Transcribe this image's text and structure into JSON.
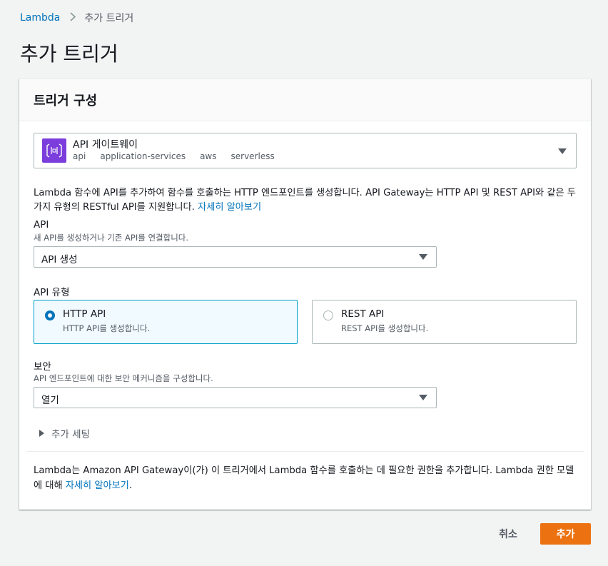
{
  "breadcrumb": {
    "root": "Lambda",
    "current": "추가 트리거"
  },
  "page": {
    "title": "추가 트리거"
  },
  "panel": {
    "title": "트리거 구성"
  },
  "trigger": {
    "name": "API 게이트웨이",
    "tags": [
      "api",
      "application-services",
      "aws",
      "serverless"
    ],
    "icon": "api-gateway-icon",
    "icon_color": "#7b3ddb"
  },
  "description": {
    "text": "Lambda 함수에 API를 추가하여 함수를 호출하는 HTTP 엔드포인트를 생성합니다. API Gateway는 HTTP API 및 REST API와 같은 두 가지 유형의 RESTful API를 지원합니다. ",
    "link": "자세히 알아보기"
  },
  "api_field": {
    "label": "API",
    "description": "새 API를 생성하거나 기존 API를 연결합니다.",
    "value": "API 생성"
  },
  "api_type": {
    "label": "API 유형",
    "options": [
      {
        "title": "HTTP API",
        "description": "HTTP API를 생성합니다.",
        "selected": true
      },
      {
        "title": "REST API",
        "description": "REST API를 생성합니다.",
        "selected": false
      }
    ]
  },
  "security": {
    "label": "보안",
    "description": "API 엔드포인트에 대한 보안 메커니즘을 구성합니다.",
    "value": "열기"
  },
  "additional_settings": {
    "label": "추가 세팅"
  },
  "footer_note": {
    "text": "Lambda는 Amazon API Gateway이(가) 이 트리거에서 Lambda 함수를 호출하는 데 필요한 권한을 추가합니다. Lambda 권한 모델에 대해 ",
    "link": "자세히 알아보기",
    "suffix": "."
  },
  "actions": {
    "cancel": "취소",
    "add": "추가"
  },
  "colors": {
    "accent": "#ec7211",
    "link": "#0073bb",
    "selected_bg": "#f1faff"
  }
}
